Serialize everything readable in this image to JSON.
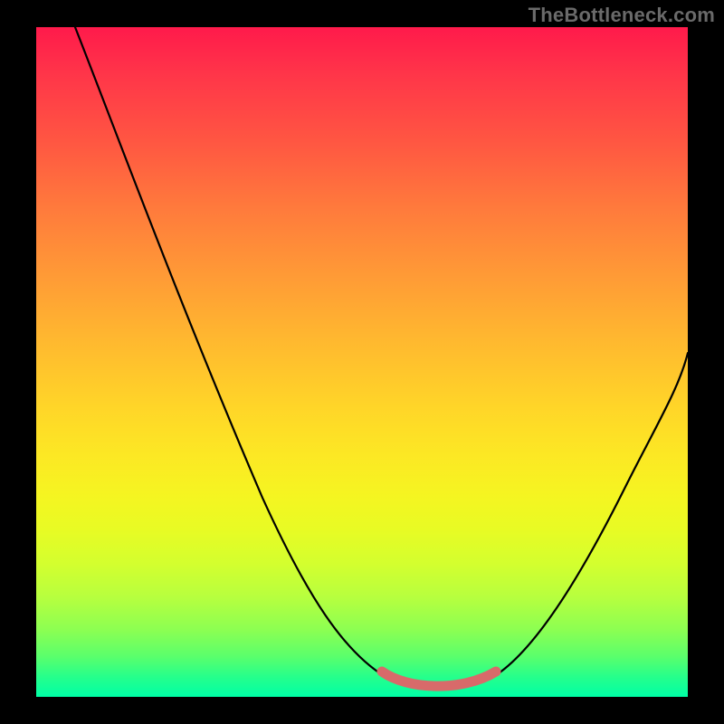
{
  "watermark": "TheBottleneck.com",
  "chart_data": {
    "type": "line",
    "title": "",
    "xlabel": "",
    "ylabel": "",
    "xlim": [
      0,
      100
    ],
    "ylim": [
      0,
      100
    ],
    "grid": false,
    "legend": false,
    "series": [
      {
        "name": "curve",
        "x": [
          6,
          10,
          15,
          20,
          25,
          30,
          35,
          40,
          44,
          48,
          52,
          55,
          57,
          59,
          62,
          66,
          70,
          72,
          76,
          80,
          85,
          90,
          95,
          100
        ],
        "values": [
          100,
          92,
          82,
          72,
          62,
          52,
          42,
          32,
          24,
          16,
          9,
          5,
          3,
          2,
          1.5,
          2,
          3,
          5,
          9,
          15,
          23,
          32,
          42,
          52
        ]
      }
    ],
    "highlight_range_x": [
      55,
      72
    ],
    "background_gradient": {
      "top": "#ff1a4b",
      "mid": "#ffe024",
      "bottom": "#00ffa6"
    }
  }
}
